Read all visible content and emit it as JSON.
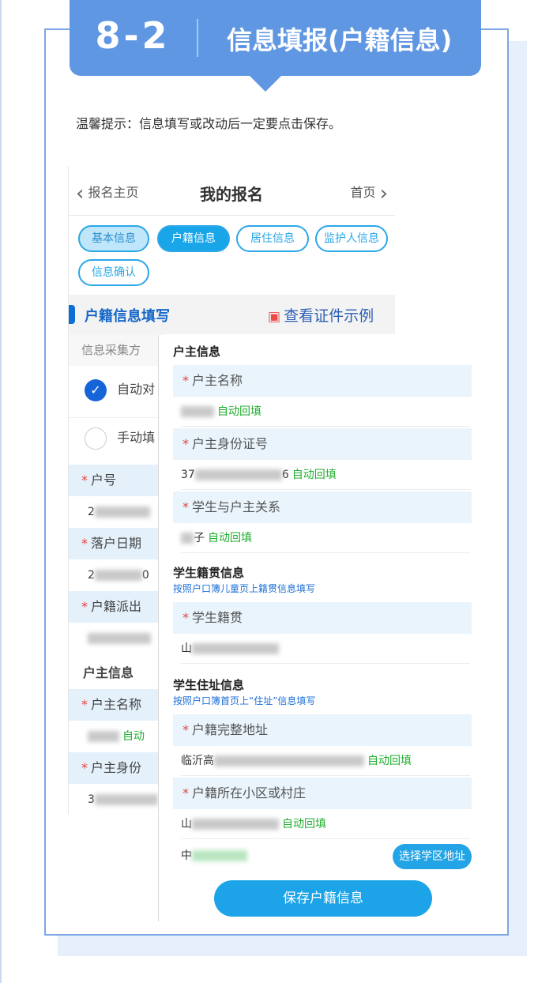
{
  "banner": {
    "number": "8-2",
    "title": "信息填报(户籍信息)"
  },
  "tip": "温馨提示：信息填写或改动后一定要点击保存。",
  "nav": {
    "back_label": "报名主页",
    "title": "我的报名",
    "home_label": "首页"
  },
  "tabs": [
    {
      "label": "基本信息"
    },
    {
      "label": "户籍信息"
    },
    {
      "label": "居住信息"
    },
    {
      "label": "监护人信息"
    },
    {
      "label": "信息确认"
    }
  ],
  "section": {
    "title": "户籍信息填写",
    "link": "查看证件示例"
  },
  "under": {
    "collect_label": "信息采集方",
    "auto_option": "自动对",
    "manual_option": "手动填",
    "hukou_no_label": "户号",
    "hukou_no_prefix": "2",
    "settle_date_label": "落户日期",
    "settle_date_prefix": "2",
    "settle_date_suffix": "0",
    "police_label": "户籍派出",
    "head_title": "户主信息",
    "head_name_label": "户主名称",
    "head_name_auto": "自动",
    "head_id_label": "户主身份",
    "head_id_prefix": "3"
  },
  "overlay": {
    "head_section_title": "户主信息",
    "head_name_label": "户主名称",
    "head_name_auto": "自动回填",
    "head_id_label": "户主身份证号",
    "head_id_prefix": "37",
    "head_id_suffix": "6",
    "head_id_auto": "自动回填",
    "relation_label": "学生与户主关系",
    "relation_value": "子",
    "relation_auto": "自动回填",
    "native_title": "学生籍贯信息",
    "native_hint": "按照户口簿儿童页上籍贯信息填写",
    "native_label": "学生籍贯",
    "native_prefix": "山",
    "address_title": "学生住址信息",
    "address_hint": "按照户口簿首页上“住址”信息填写",
    "full_address_label": "户籍完整地址",
    "full_address_prefix": "临沂高",
    "full_address_suffix": "",
    "full_address_auto": "自动回填",
    "community_label": "户籍所在小区或村庄",
    "community_prefix": "山",
    "community_auto": "自动回填",
    "district_prefix": "中",
    "select_button": "选择学区地址",
    "save_button": "保存户籍信息"
  },
  "colors": {
    "banner": "#5f97e3",
    "accent": "#1da4e8",
    "auto_fill": "#1fae2e",
    "required": "#e94040"
  }
}
